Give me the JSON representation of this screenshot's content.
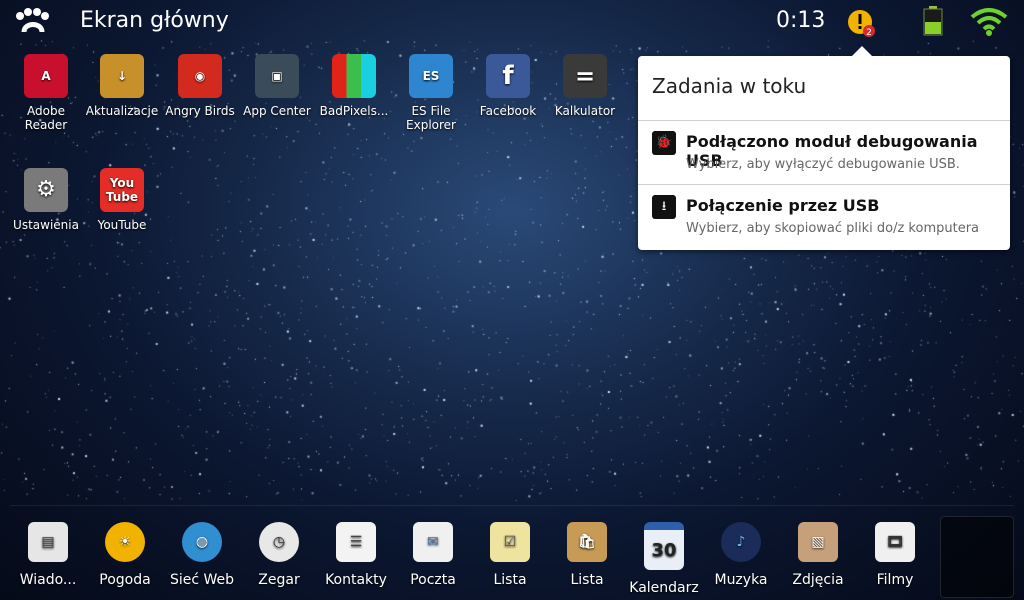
{
  "status_bar": {
    "title": "Ekran główny",
    "time": "0:13",
    "notification_count": "2",
    "icons": [
      "launcher-logo-icon",
      "warning-icon",
      "battery-icon",
      "wifi-icon"
    ]
  },
  "apps": [
    {
      "label": "Adobe Reader",
      "icon": "adobe-reader-icon",
      "color": "#c8102e"
    },
    {
      "label": "Aktualizacje",
      "icon": "update-box-icon",
      "color": "#c8902a"
    },
    {
      "label": "Angry Birds",
      "icon": "angry-birds-icon",
      "color": "#d22a1e"
    },
    {
      "label": "App Center",
      "icon": "app-center-icon",
      "color": "#3a4b59"
    },
    {
      "label": "BadPixels...",
      "icon": "badpixels-icon",
      "color": "#3bbf4c"
    },
    {
      "label": "ES File Explorer",
      "icon": "es-file-explorer-icon",
      "color": "#2f86d0"
    },
    {
      "label": "Facebook",
      "icon": "facebook-icon",
      "color": "#3b5998"
    },
    {
      "label": "Kalkulator",
      "icon": "calculator-icon",
      "color": "#3a3a3a"
    },
    {
      "label": "Ustawienia",
      "icon": "settings-gears-icon",
      "color": "#7a7a7a"
    },
    {
      "label": "YouTube",
      "icon": "youtube-icon",
      "color": "#e52d27"
    }
  ],
  "notification_panel": {
    "title": "Zadania w toku",
    "items": [
      {
        "title": "Podłączono moduł debugowania USB",
        "subtitle": "Wybierz, aby wyłączyć debugowanie USB.",
        "icon": "android-debug-icon"
      },
      {
        "title": "Połączenie przez USB",
        "subtitle": "Wybierz, aby skopiować pliki do/z komputera",
        "icon": "usb-icon"
      }
    ]
  },
  "dock": [
    {
      "label": "Wiado...",
      "icon": "news-icon",
      "color": "#e6e6e6"
    },
    {
      "label": "Pogoda",
      "icon": "weather-sun-icon",
      "color": "#f2b300"
    },
    {
      "label": "Sieć Web",
      "icon": "globe-icon",
      "color": "#2f8fd0"
    },
    {
      "label": "Zegar",
      "icon": "clock-icon",
      "color": "#e8e8e8"
    },
    {
      "label": "Kontakty",
      "icon": "contacts-icon",
      "color": "#f3f3f3"
    },
    {
      "label": "Poczta",
      "icon": "mail-icon",
      "color": "#f0f0f0"
    },
    {
      "label": "Lista",
      "icon": "checklist-icon",
      "color": "#efe3a0"
    },
    {
      "label": "Lista",
      "icon": "shopping-bag-icon",
      "color": "#c79a55"
    },
    {
      "label": "Kalendarz",
      "icon": "calendar-icon",
      "color": "#e9eef7",
      "text": "30"
    },
    {
      "label": "Muzyka",
      "icon": "music-icon",
      "color": "#1b2c5a"
    },
    {
      "label": "Zdjęcia",
      "icon": "photos-icon",
      "color": "#c6a07a"
    },
    {
      "label": "Filmy",
      "icon": "film-icon",
      "color": "#f0f0f0"
    }
  ],
  "colors": {
    "accent": "#00c853",
    "warning": "#f2b300"
  }
}
